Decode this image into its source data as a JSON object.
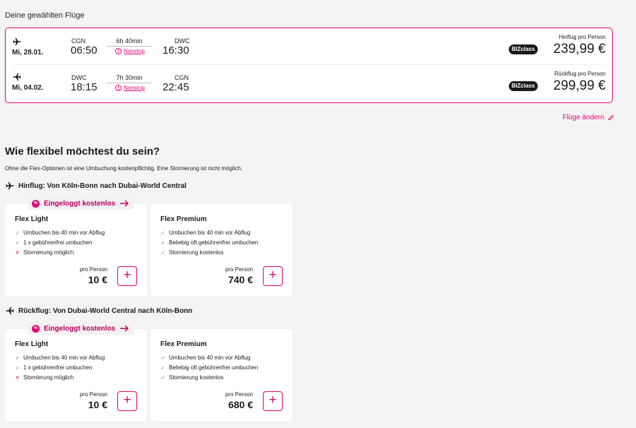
{
  "section_title": "Deine gewählten Flüge",
  "flights": [
    {
      "direction_icon": "plane-departure-icon",
      "date": "Mi, 28.01.",
      "dep_code": "CGN",
      "dep_time": "06:50",
      "duration": "6h 40min",
      "stops": "Nonstop",
      "arr_code": "DWC",
      "arr_time": "16:30",
      "class_badge": "BIZclass",
      "price_label": "Hinflug pro Person",
      "price": "239,99 €"
    },
    {
      "direction_icon": "plane-return-icon",
      "date": "Mi, 04.02.",
      "dep_code": "DWC",
      "dep_time": "18:15",
      "duration": "7h 30min",
      "stops": "Nonstop",
      "arr_code": "CGN",
      "arr_time": "22:45",
      "class_badge": "BIZclass",
      "price_label": "Rückflug pro Person",
      "price": "299,99 €"
    }
  ],
  "change_flights": "Flüge ändern",
  "flex": {
    "heading": "Wie flexibel möchtest du sein?",
    "subtitle": "Ohne die Flex-Optionen ist eine Umbuchung kostenpflichtig. Eine Stornierung ist nicht möglich.",
    "promo_text": "Eingeloggt kostenlos",
    "promo_badge": "%",
    "per_person": "pro Person",
    "legs": [
      {
        "title": "Hinflug: Von Köln-Bonn nach Dubai-World Central",
        "options": [
          {
            "name": "Flex Light",
            "features": [
              {
                "ok": true,
                "text": "Umbuchen bis 40 min vor Abflug"
              },
              {
                "ok": true,
                "text": "1 x gebührenfrei umbuchen"
              },
              {
                "ok": false,
                "text": "Stornierung möglich"
              }
            ],
            "price": "10 €"
          },
          {
            "name": "Flex Premium",
            "features": [
              {
                "ok": true,
                "text": "Umbuchen bis 40 min vor Abflug"
              },
              {
                "ok": true,
                "text": "Beliebig oft gebührenfrei umbuchen"
              },
              {
                "ok": true,
                "text": "Stornierung kostenlos"
              }
            ],
            "price": "740 €"
          }
        ]
      },
      {
        "title": "Rückflug: Von Dubai-World Central nach Köln-Bonn",
        "options": [
          {
            "name": "Flex Light",
            "features": [
              {
                "ok": true,
                "text": "Umbuchen bis 40 min vor Abflug"
              },
              {
                "ok": true,
                "text": "1 x gebührenfrei umbuchen"
              },
              {
                "ok": false,
                "text": "Stornierung möglich"
              }
            ],
            "price": "10 €"
          },
          {
            "name": "Flex Premium",
            "features": [
              {
                "ok": true,
                "text": "Umbuchen bis 40 min vor Abflug"
              },
              {
                "ok": true,
                "text": "Beliebig oft gebührenfrei umbuchen"
              },
              {
                "ok": true,
                "text": "Stornierung kostenlos"
              }
            ],
            "price": "680 €"
          }
        ]
      }
    ]
  },
  "colors": {
    "accent": "#e20074",
    "success": "#2aa05a",
    "error": "#d0021b",
    "background": "#f4f4f4"
  }
}
